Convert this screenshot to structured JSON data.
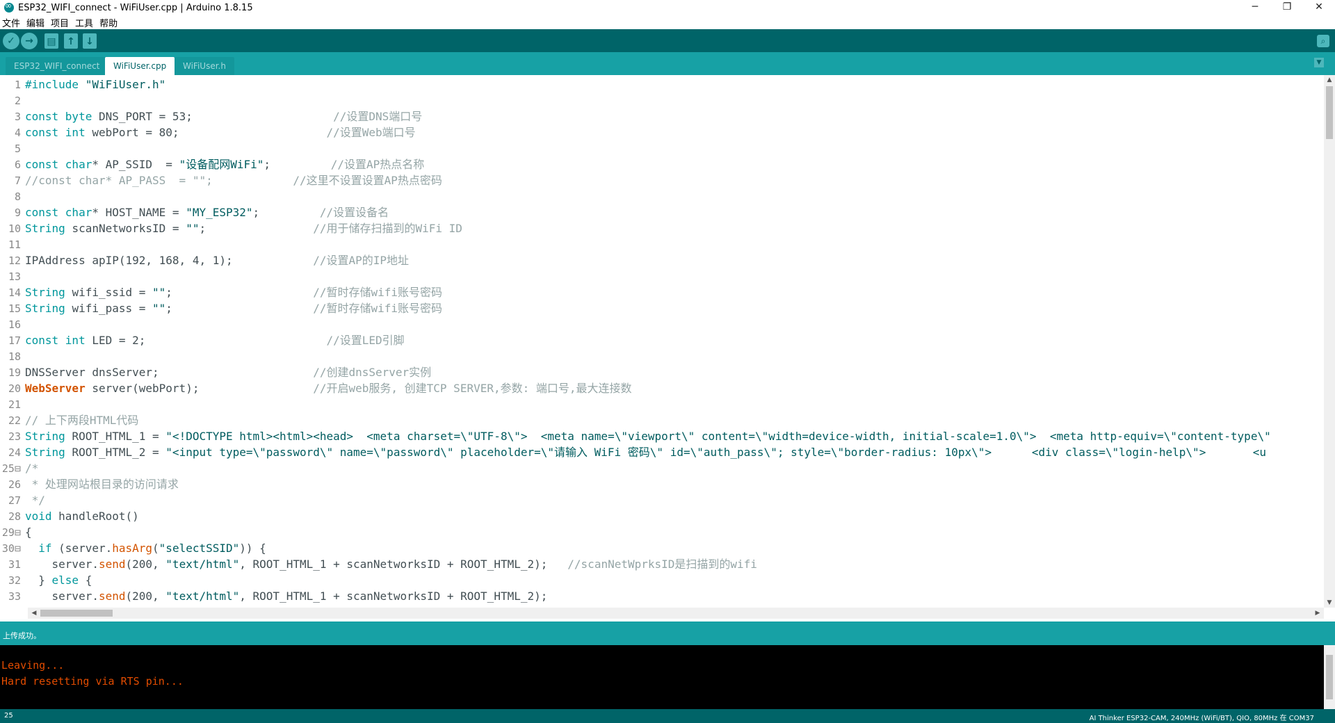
{
  "window": {
    "title": "ESP32_WIFI_connect - WiFiUser.cpp | Arduino 1.8.15",
    "minimize": "─",
    "restore": "❐",
    "close": "✕"
  },
  "menu": [
    "文件",
    "编辑",
    "项目",
    "工具",
    "帮助"
  ],
  "toolbar": {
    "verify": "✓",
    "upload": "→",
    "new": "▤",
    "open": "↑",
    "save": "↓",
    "serial_monitor": "⌕"
  },
  "tabs": [
    {
      "label": "ESP32_WIFI_connect",
      "active": false
    },
    {
      "label": "WiFiUser.cpp",
      "active": true
    },
    {
      "label": "WiFiUser.h",
      "active": false
    }
  ],
  "tab_menu": "▼",
  "editor": {
    "lines": [
      {
        "n": "1",
        "parts": [
          [
            "kw",
            "#include "
          ],
          [
            "str",
            "\"WiFiUser.h\""
          ]
        ]
      },
      {
        "n": "2",
        "parts": []
      },
      {
        "n": "3",
        "parts": [
          [
            "kw",
            "const "
          ],
          [
            "ty",
            "byte "
          ],
          [
            "code",
            "DNS_PORT = 53;                     "
          ],
          [
            "cmt",
            "//设置DNS端口号"
          ]
        ]
      },
      {
        "n": "4",
        "parts": [
          [
            "kw",
            "const "
          ],
          [
            "ty",
            "int "
          ],
          [
            "code",
            "webPort = 80;                      "
          ],
          [
            "cmt",
            "//设置Web端口号"
          ]
        ]
      },
      {
        "n": "5",
        "parts": []
      },
      {
        "n": "6",
        "parts": [
          [
            "kw",
            "const "
          ],
          [
            "ty",
            "char"
          ],
          [
            "code",
            "* AP_SSID  = "
          ],
          [
            "str",
            "\"设备配网WiFi\""
          ],
          [
            "code",
            ";         "
          ],
          [
            "cmt",
            "//设置AP热点名称"
          ]
        ]
      },
      {
        "n": "7",
        "parts": [
          [
            "cmt",
            "//const char* AP_PASS  = \"\";            //这里不设置设置AP热点密码"
          ]
        ]
      },
      {
        "n": "8",
        "parts": []
      },
      {
        "n": "9",
        "parts": [
          [
            "kw",
            "const "
          ],
          [
            "ty",
            "char"
          ],
          [
            "code",
            "* HOST_NAME = "
          ],
          [
            "str",
            "\"MY_ESP32\""
          ],
          [
            "code",
            ";         "
          ],
          [
            "cmt",
            "//设置设备名"
          ]
        ]
      },
      {
        "n": "10",
        "parts": [
          [
            "ty",
            "String "
          ],
          [
            "code",
            "scanNetworksID = "
          ],
          [
            "str",
            "\"\""
          ],
          [
            "code",
            ";                "
          ],
          [
            "cmt",
            "//用于储存扫描到的WiFi ID"
          ]
        ]
      },
      {
        "n": "11",
        "parts": []
      },
      {
        "n": "12",
        "parts": [
          [
            "code",
            "IPAddress apIP(192, 168, 4, 1);            "
          ],
          [
            "cmt",
            "//设置AP的IP地址"
          ]
        ]
      },
      {
        "n": "13",
        "parts": []
      },
      {
        "n": "14",
        "parts": [
          [
            "ty",
            "String "
          ],
          [
            "code",
            "wifi_ssid = "
          ],
          [
            "str",
            "\"\""
          ],
          [
            "code",
            ";                     "
          ],
          [
            "cmt",
            "//暂时存储wifi账号密码"
          ]
        ]
      },
      {
        "n": "15",
        "parts": [
          [
            "ty",
            "String "
          ],
          [
            "code",
            "wifi_pass = "
          ],
          [
            "str",
            "\"\""
          ],
          [
            "code",
            ";                     "
          ],
          [
            "cmt",
            "//暂时存储wifi账号密码"
          ]
        ]
      },
      {
        "n": "16",
        "parts": []
      },
      {
        "n": "17",
        "parts": [
          [
            "kw",
            "const "
          ],
          [
            "ty",
            "int "
          ],
          [
            "code",
            "LED = 2;                           "
          ],
          [
            "cmt",
            "//设置LED引脚"
          ]
        ]
      },
      {
        "n": "18",
        "parts": []
      },
      {
        "n": "19",
        "parts": [
          [
            "code",
            "DNSServer dnsServer;                       "
          ],
          [
            "cmt",
            "//创建dnsServer实例"
          ]
        ]
      },
      {
        "n": "20",
        "parts": [
          [
            "red",
            "WebServer "
          ],
          [
            "code",
            "server(webPort);                 "
          ],
          [
            "cmt",
            "//开启web服务, 创建TCP SERVER,参数: 端口号,最大连接数"
          ]
        ]
      },
      {
        "n": "21",
        "parts": []
      },
      {
        "n": "22",
        "parts": [
          [
            "cmt",
            "// 上下两段HTML代码"
          ]
        ]
      },
      {
        "n": "23",
        "parts": [
          [
            "ty",
            "String "
          ],
          [
            "code",
            "ROOT_HTML_1 = "
          ],
          [
            "str",
            "\"<!DOCTYPE html><html><head>  <meta charset=\\\"UTF-8\\\">  <meta name=\\\"viewport\\\" content=\\\"width=device-width, initial-scale=1.0\\\">  <meta http-equiv=\\\"content-type\\\""
          ]
        ]
      },
      {
        "n": "24",
        "parts": [
          [
            "ty",
            "String "
          ],
          [
            "code",
            "ROOT_HTML_2 = "
          ],
          [
            "str",
            "\"<input type=\\\"password\\\" name=\\\"password\\\" placeholder=\\\"请输入 WiFi 密码\\\" id=\\\"auth_pass\\\"; style=\\\"border-radius: 10px\\\">      <div class=\\\"login-help\\\">       <u"
          ]
        ]
      },
      {
        "n": "25⊟",
        "parts": [
          [
            "cmt",
            "/*"
          ]
        ]
      },
      {
        "n": "26",
        "parts": [
          [
            "cmt",
            " * 处理网站根目录的访问请求"
          ]
        ]
      },
      {
        "n": "27",
        "parts": [
          [
            "cmt",
            " */"
          ]
        ]
      },
      {
        "n": "28",
        "parts": [
          [
            "ty",
            "void "
          ],
          [
            "code",
            "handleRoot()"
          ]
        ]
      },
      {
        "n": "29⊟",
        "parts": [
          [
            "code",
            "{"
          ]
        ]
      },
      {
        "n": "30⊟",
        "parts": [
          [
            "code",
            "  "
          ],
          [
            "kw",
            "if "
          ],
          [
            "code",
            "(server."
          ],
          [
            "fn",
            "hasArg"
          ],
          [
            "code",
            "("
          ],
          [
            "str",
            "\"selectSSID\""
          ],
          [
            "code",
            ")) {"
          ]
        ]
      },
      {
        "n": "31",
        "parts": [
          [
            "code",
            "    server."
          ],
          [
            "fn",
            "send"
          ],
          [
            "code",
            "(200, "
          ],
          [
            "str",
            "\"text/html\""
          ],
          [
            "code",
            ", ROOT_HTML_1 + scanNetworksID + ROOT_HTML_2);   "
          ],
          [
            "cmt",
            "//scanNetWprksID是扫描到的wifi"
          ]
        ]
      },
      {
        "n": "32",
        "parts": [
          [
            "code",
            "  } "
          ],
          [
            "kw",
            "else "
          ],
          [
            "code",
            "{"
          ]
        ]
      },
      {
        "n": "33",
        "parts": [
          [
            "code",
            "    server."
          ],
          [
            "fn",
            "send"
          ],
          [
            "code",
            "(200, "
          ],
          [
            "str",
            "\"text/html\""
          ],
          [
            "code",
            ", ROOT_HTML_1 + scanNetworksID + ROOT_HTML_2);"
          ]
        ]
      }
    ]
  },
  "scroll": {
    "up": "▲",
    "down": "▼",
    "left": "◀",
    "right": "▶"
  },
  "status": {
    "message": "上传成功。"
  },
  "console": {
    "lines": [
      "Leaving...",
      "Hard resetting via RTS pin..."
    ]
  },
  "footer": {
    "line_number": "25",
    "board_info": "AI Thinker ESP32-CAM, 240MHz (WiFi/BT), QIO, 80MHz 在 COM37"
  }
}
